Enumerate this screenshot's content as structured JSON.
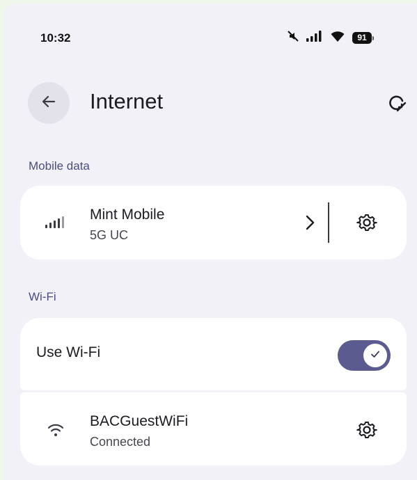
{
  "status_bar": {
    "time": "10:32",
    "icons": [
      "mute-icon",
      "signal-icon",
      "wifi-icon",
      "battery-icon"
    ],
    "battery_level": "91"
  },
  "header": {
    "title": "Internet",
    "back_icon": "arrow-left-icon",
    "refresh_icon": "refresh-icon"
  },
  "mobile_data": {
    "section_label": "Mobile data",
    "carrier": "Mint Mobile",
    "network_type": "5G UC",
    "icons": [
      "signal-bars-icon",
      "chevron-right-icon",
      "gear-icon"
    ]
  },
  "wifi": {
    "section_label": "Wi-Fi",
    "toggle_label": "Use Wi-Fi",
    "toggle_on": true,
    "network": {
      "ssid": "BACGuestWiFi",
      "status": "Connected",
      "icons": [
        "wifi-icon",
        "gear-icon"
      ]
    }
  },
  "colors": {
    "accent": "#5b5b8f",
    "section_label": "#4b4d7e",
    "background": "#f2f1f7",
    "card": "#ffffff"
  }
}
